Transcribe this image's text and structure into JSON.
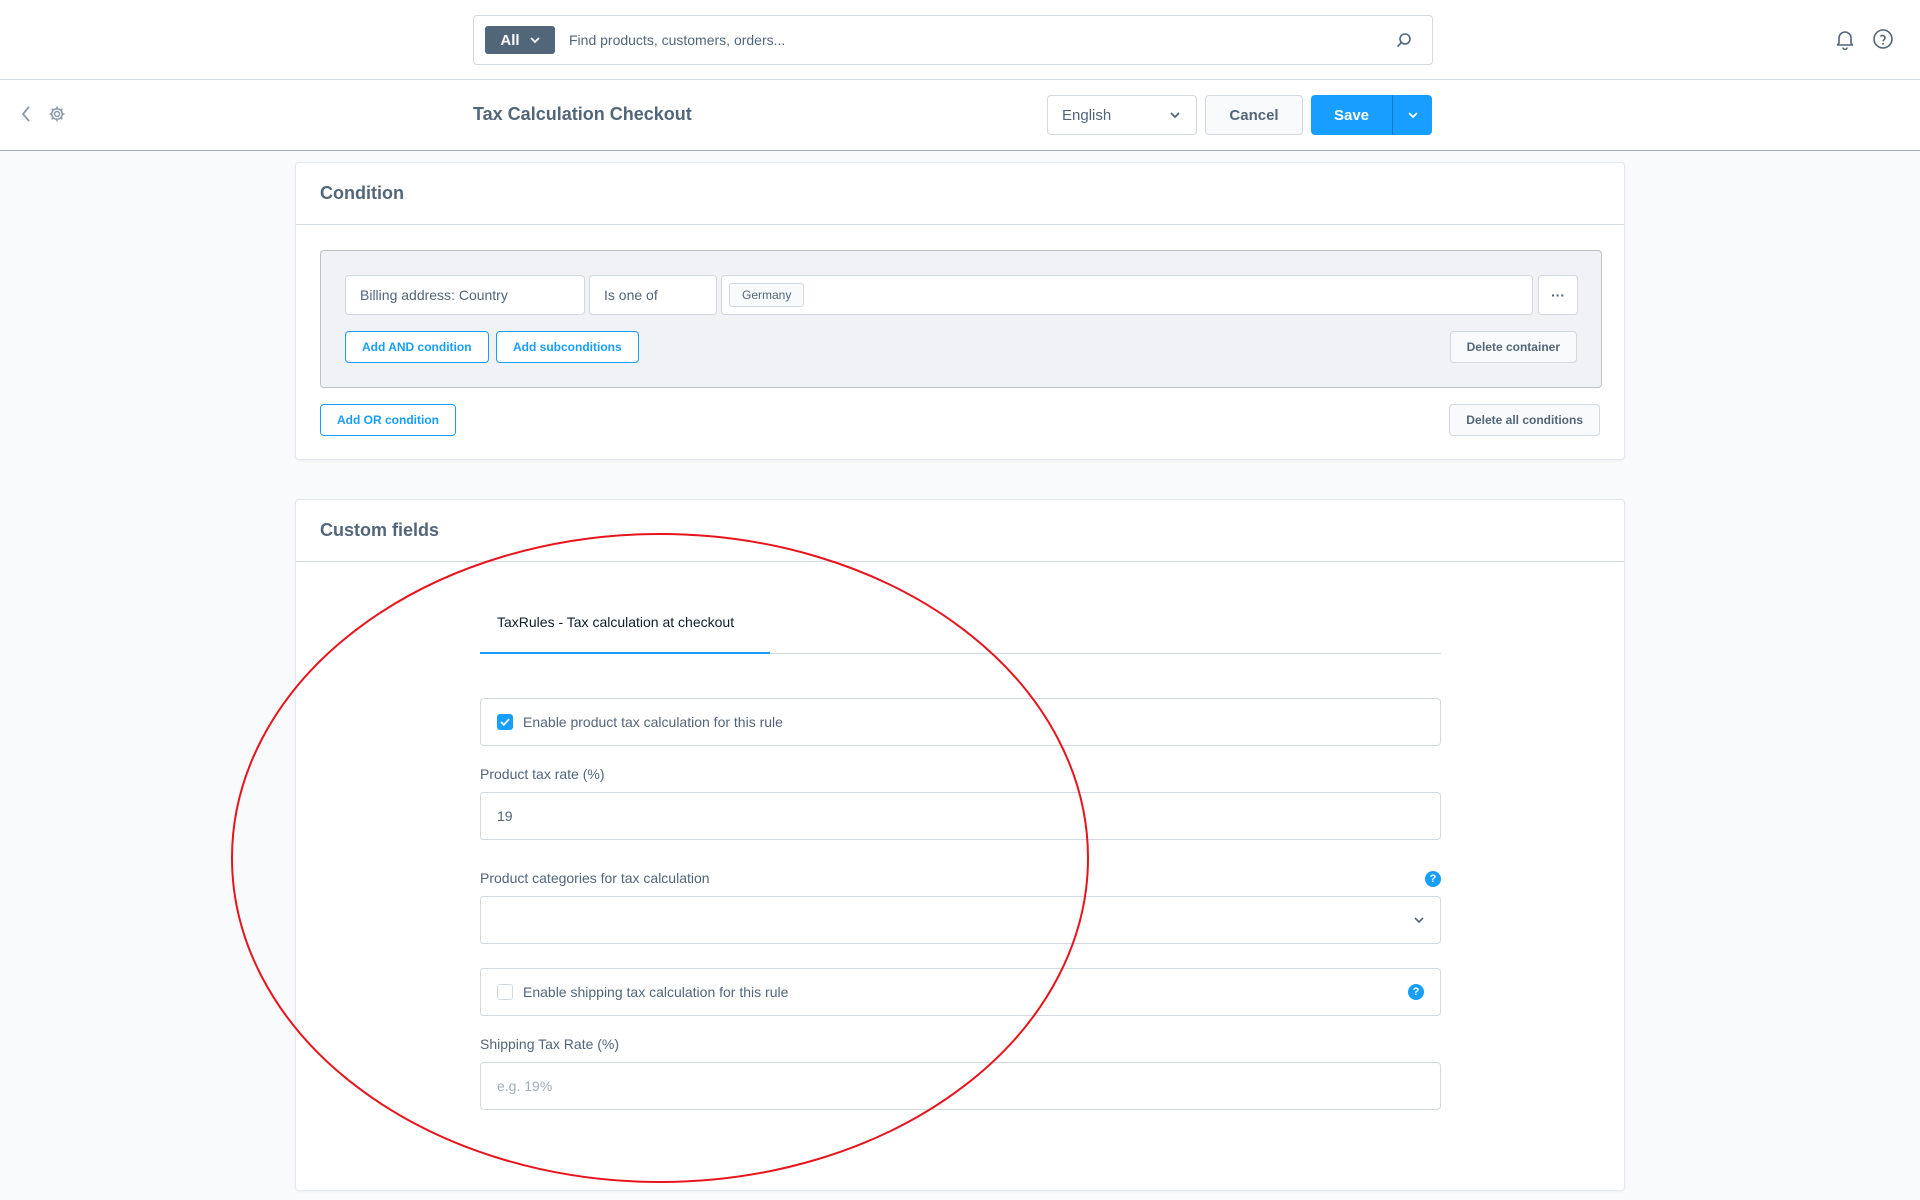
{
  "topbar": {
    "search_type": "All",
    "search_placeholder": "Find products, customers, orders..."
  },
  "smartbar": {
    "title": "Tax Calculation Checkout",
    "language": "English",
    "cancel_label": "Cancel",
    "save_label": "Save"
  },
  "condition": {
    "title": "Condition",
    "field": "Billing address: Country",
    "operator": "Is one of",
    "value_tag": "Germany",
    "more_label": "···",
    "add_and_label": "Add AND condition",
    "add_sub_label": "Add subconditions",
    "delete_container_label": "Delete container",
    "add_or_label": "Add OR condition",
    "delete_all_label": "Delete all conditions"
  },
  "custom_fields": {
    "title": "Custom fields",
    "tab_label": "TaxRules - Tax calculation at checkout",
    "enable_product_label": "Enable product tax calculation for this rule",
    "enable_product_checked": true,
    "product_rate_label": "Product tax rate (%)",
    "product_rate_value": "19",
    "categories_label": "Product categories for tax calculation",
    "enable_shipping_label": "Enable shipping tax calculation for this rule",
    "enable_shipping_checked": false,
    "shipping_rate_label": "Shipping Tax Rate (%)",
    "shipping_rate_placeholder": "e.g. 19%",
    "help_glyph": "?"
  },
  "colors": {
    "accent": "#189eff",
    "text": "#52667a",
    "annotation": "#e8141b"
  }
}
